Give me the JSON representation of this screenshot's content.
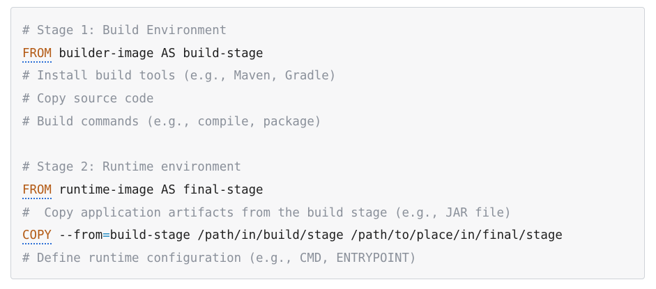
{
  "code": {
    "line1": "# Stage 1: Build Environment",
    "line2_kw": "FROM",
    "line2_rest": " builder-image AS build-stage",
    "line3": "# Install build tools (e.g., Maven, Gradle)",
    "line4": "# Copy source code",
    "line5": "# Build commands (e.g., compile, package)",
    "line6": "",
    "line7": "# Stage 2: Runtime environment",
    "line8_kw": "FROM",
    "line8_rest": " runtime-image AS final-stage",
    "line9": "#  Copy application artifacts from the build stage (e.g., JAR file)",
    "line10_kw": "COPY",
    "line10_flag": " --from",
    "line10_op": "=",
    "line10_rest": "build-stage /path/in/build/stage /path/to/place/in/final/stage",
    "line11": "# Define runtime configuration (e.g., CMD, ENTRYPOINT)"
  },
  "colors": {
    "comment": "#8a909a",
    "keyword": "#b35a14",
    "operator": "#2a8fc4",
    "text": "#1e1e1e",
    "background": "#f7f7f8"
  }
}
